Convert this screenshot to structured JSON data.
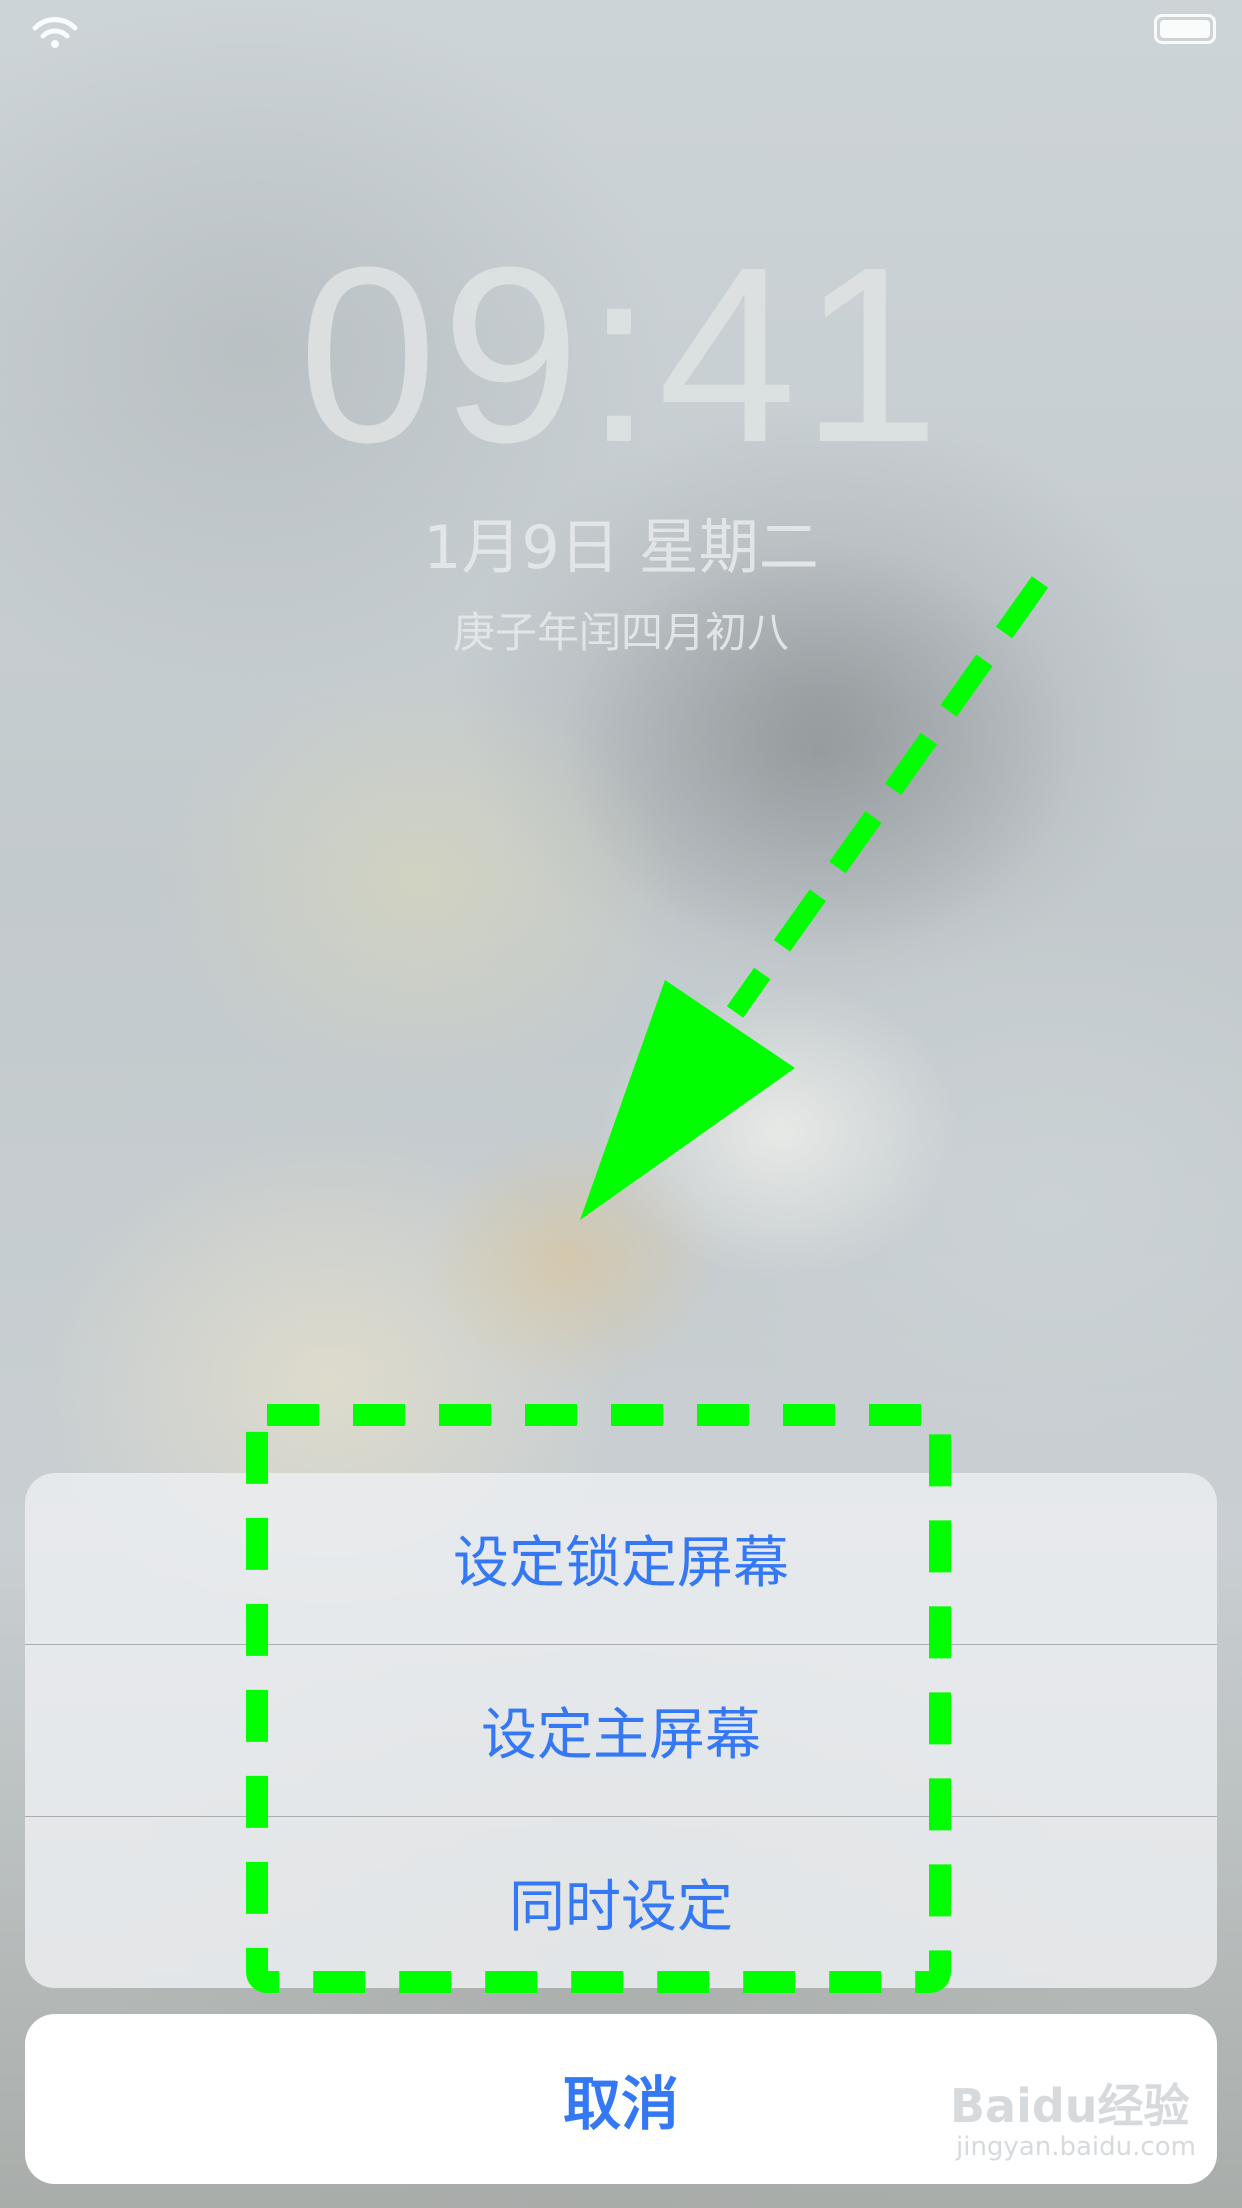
{
  "status_bar": {
    "wifi_icon": "wifi-icon",
    "battery_icon": "battery-icon"
  },
  "lock_screen": {
    "time": "09:41",
    "date": "1月9日 星期二",
    "lunar_date": "庚子年闰四月初八"
  },
  "action_sheet": {
    "options": [
      {
        "label": "设定锁定屏幕"
      },
      {
        "label": "设定主屏幕"
      },
      {
        "label": "同时设定"
      }
    ],
    "cancel_label": "取消"
  },
  "annotation": {
    "color": "#00ff00",
    "arrow_icon": "arrow-down-left-icon"
  },
  "watermark": {
    "brand": "Baidu经验",
    "url": "jingyan.baidu.com"
  },
  "colors": {
    "accent": "#3478f6",
    "sheet_bg": "#ebeef0",
    "cancel_bg": "#ffffff"
  }
}
